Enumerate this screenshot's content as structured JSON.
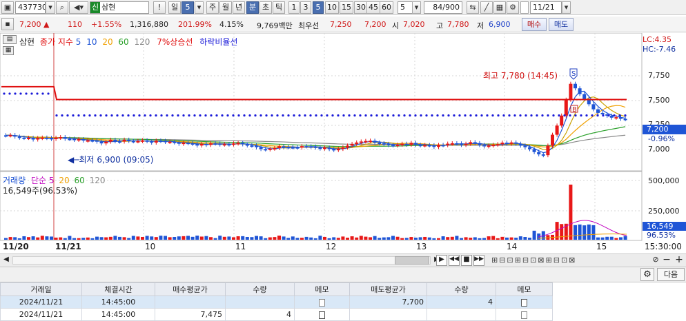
{
  "toolbar": {
    "code": "437730",
    "market_badge": "신",
    "stock_name": "삼현",
    "periods": [
      "일",
      "5"
    ],
    "timeframes": [
      "주",
      "월",
      "년",
      "분",
      "초",
      "틱"
    ],
    "minutes": [
      "1",
      "3",
      "5",
      "10",
      "15",
      "30",
      "45",
      "60"
    ],
    "count_value": "5",
    "page_counter": "84",
    "page_total": "/900",
    "date_value": "11/21",
    "exclamation": "!"
  },
  "quote": {
    "price": "7,200",
    "direction": "▲",
    "change": "110",
    "change_rate": "+1.55%",
    "volume": "1,316,880",
    "vol_ratio": "201.99%",
    "turnover": "4.15%",
    "amount": "9,769백만",
    "best_label": "최우선",
    "best_ask": "7,250",
    "best_bid": "7,200",
    "open_label": "시",
    "open": "7,020",
    "high_label": "고",
    "high": "7,780",
    "low_label": "저",
    "low": "6,900",
    "buy_button": "매수",
    "sell_button": "매도"
  },
  "legend": {
    "name": "삼현",
    "close_label": "종가 지수",
    "ma": [
      "5",
      "10",
      "20",
      "60",
      "120"
    ],
    "rise_line": "7%상승선",
    "fall_line": "하락비율선",
    "volume_label": "거래량",
    "simple_label": "단순",
    "volume_ma": [
      "5",
      "20",
      "60",
      "120"
    ],
    "volume_info": "16,549주(96.53%)"
  },
  "annotations": {
    "high": "최고 7,780 (14:45)",
    "low": "최저 6,900 (09:05)",
    "sell_marker": "S",
    "buy_marker": "B"
  },
  "axis": {
    "lc": "LC:4.35",
    "hc": "HC:-7.46",
    "price_ticks": [
      "7,750",
      "7,500",
      "7,250",
      "7,000"
    ],
    "current_price": "7,200",
    "current_rate": "-0.96%",
    "volume_ticks": [
      "500,000",
      "250,000"
    ],
    "current_volume": "16,549",
    "current_vol_rate": "96.53%",
    "time_labels": [
      "11/20",
      "11/21",
      "10",
      "11",
      "12",
      "13",
      "14",
      "15",
      "15:30:00"
    ]
  },
  "panel": {
    "next_button": "다음"
  },
  "table": {
    "headers": [
      "거래일",
      "체결시간",
      "매수평균가",
      "수량",
      "메모",
      "매도평균가",
      "수량",
      "메모"
    ],
    "rows": [
      {
        "date": "2024/11/21",
        "time": "14:45:00",
        "buy_avg": "",
        "buy_qty": "",
        "sell_avg": "7,700",
        "sell_qty": "4"
      },
      {
        "date": "2024/11/21",
        "time": "14:45:00",
        "buy_avg": "7,475",
        "buy_qty": "4",
        "sell_avg": "",
        "sell_qty": ""
      }
    ]
  },
  "colors": {
    "up": "#e81818",
    "down": "#1f55d6",
    "ma5": "#1f55d6",
    "ma10": "#c8a000",
    "ma20": "#f0a000",
    "ma60": "#2aa02a",
    "ma120": "#888888",
    "rise_line": "#e01010",
    "fall_line": "#1a1ad8"
  }
}
